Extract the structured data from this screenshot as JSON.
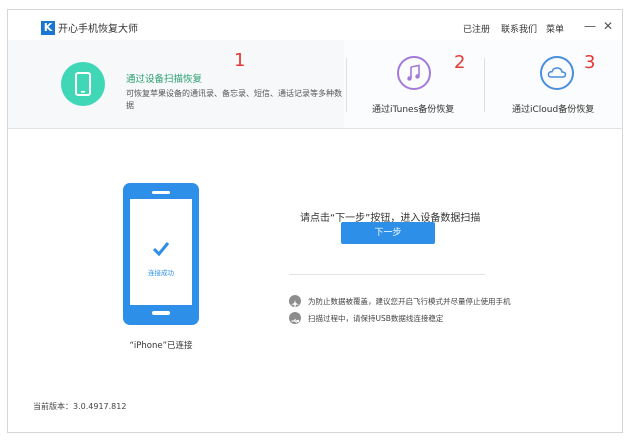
{
  "titlebar": {
    "logo_letter": "K",
    "app_title": "开心手机恢复大师",
    "menu": [
      "已注册",
      "联系我们",
      "菜单"
    ],
    "minimize": "—",
    "close": "✕"
  },
  "tabs": {
    "device": {
      "title": "通过设备扫描恢复",
      "description": "可恢复苹果设备的通讯录、备忘录、短信、通话记录等多种数据",
      "annotation": "1"
    },
    "itunes": {
      "label": "通过iTunes备份恢复",
      "annotation": "2"
    },
    "icloud": {
      "label": "通过iCloud备份恢复",
      "annotation": "3"
    }
  },
  "phone": {
    "status": "连接成功",
    "caption": "“iPhone”已连接"
  },
  "main": {
    "prompt": "请点击“下一步”按钮，进入设备数据扫描",
    "next_button": "下一步",
    "tips": [
      "为防止数据被覆盖，建议您开启飞行模式并尽量停止使用手机",
      "扫描过程中，请保持USB数据线连接稳定"
    ]
  },
  "footer": {
    "version": "当前版本：3.0.4917.812"
  },
  "colors": {
    "accent": "#2e8fe8",
    "teal": "#3fd7b5",
    "green_text": "#2a9d6e",
    "annotation_red": "#e53935"
  }
}
